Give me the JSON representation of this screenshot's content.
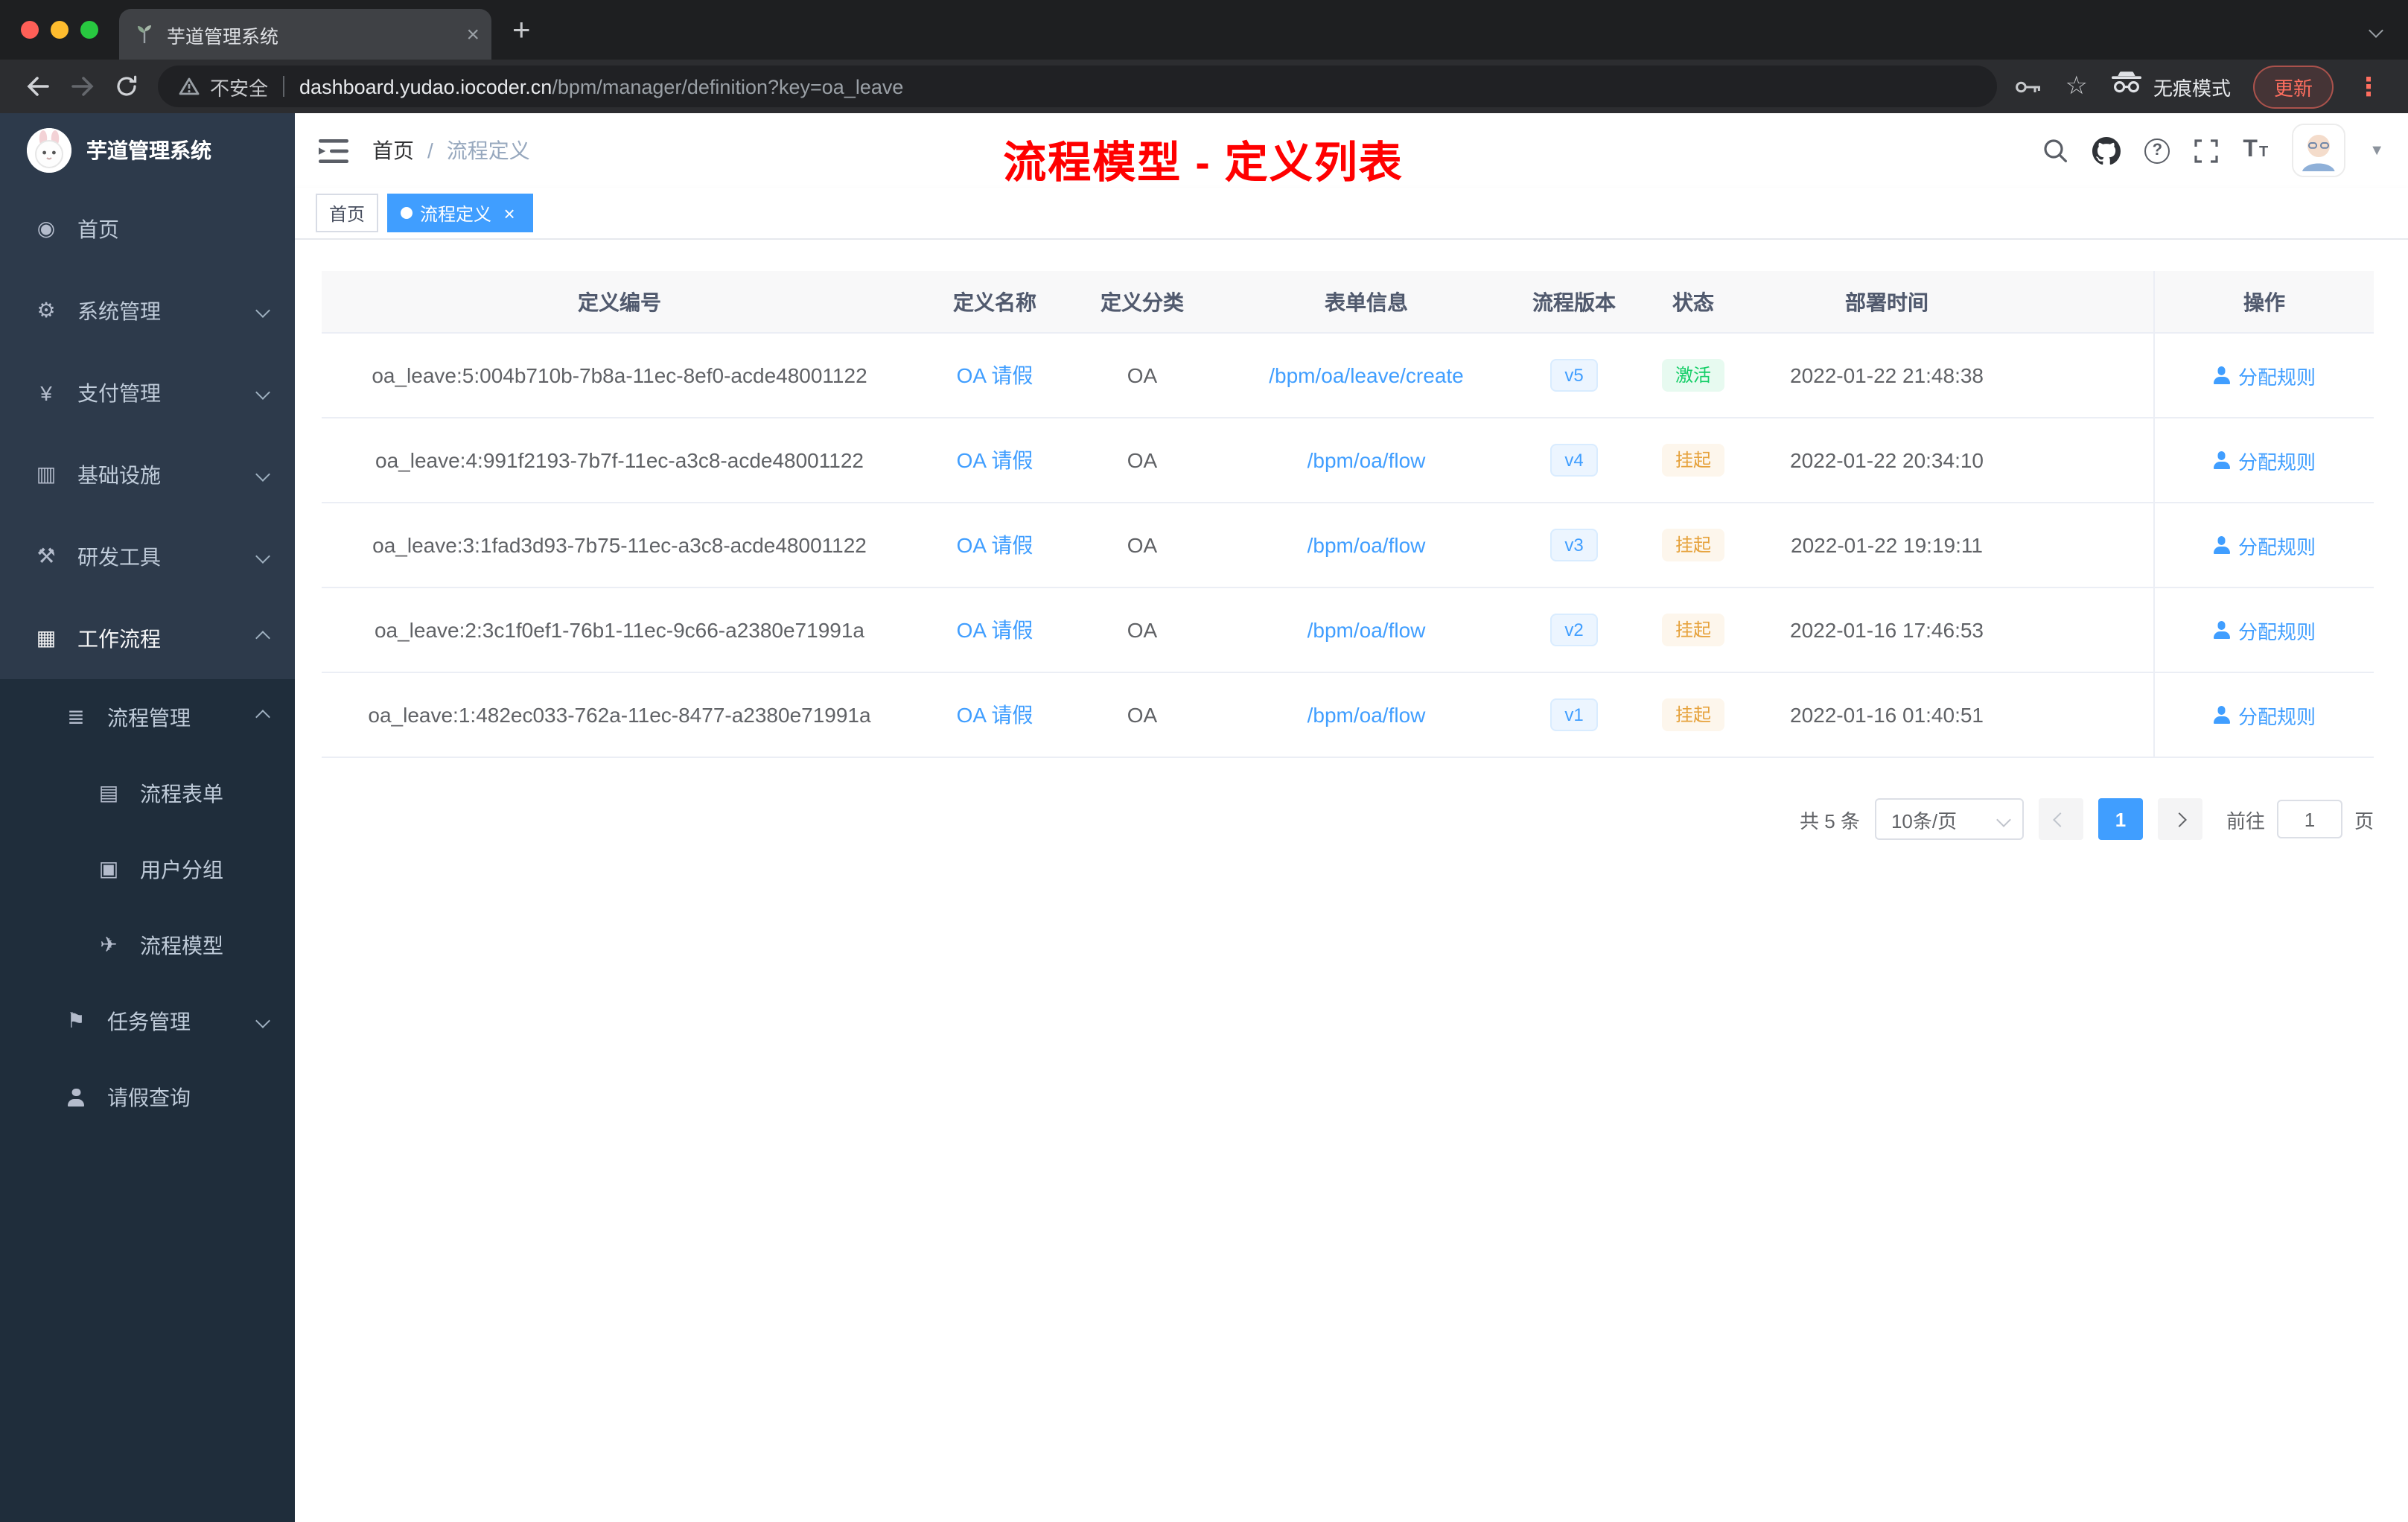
{
  "browser": {
    "tab_title": "芋道管理系统",
    "address": {
      "security_label": "不安全",
      "url_host": "dashboard.yudao.iocoder.cn",
      "url_path": "/bpm/manager/definition?key=oa_leave",
      "incognito_label": "无痕模式",
      "update_label": "更新"
    }
  },
  "glyphs": {
    "new_tab": "+",
    "tab_close": "×",
    "tag_close": "×",
    "menu_dots": "⋮",
    "star": "☆",
    "avatar_caret": "▼",
    "help": "?",
    "font_large": "T",
    "font_small": "T"
  },
  "sidebar": {
    "logo_title": "芋道管理系统",
    "menu": [
      {
        "label": "首页",
        "icon": "◉"
      },
      {
        "label": "系统管理",
        "icon": "⚙"
      },
      {
        "label": "支付管理",
        "icon": "¥"
      },
      {
        "label": "基础设施",
        "icon": "▥"
      },
      {
        "label": "研发工具",
        "icon": "⚒"
      },
      {
        "label": "工作流程",
        "icon": "▦"
      },
      {
        "label": "流程管理",
        "icon": "≣"
      },
      {
        "label": "流程表单",
        "icon": "▤"
      },
      {
        "label": "用户分组",
        "icon": "▣"
      },
      {
        "label": "流程模型",
        "icon": "✈"
      },
      {
        "label": "任务管理",
        "icon": "⚑"
      },
      {
        "label": "请假查询",
        "icon": ""
      }
    ]
  },
  "header": {
    "breadcrumb": {
      "home": "首页",
      "separator": "/",
      "current": "流程定义"
    },
    "overlay_title": "流程模型 - 定义列表"
  },
  "tags": [
    {
      "label": "首页"
    },
    {
      "label": "流程定义"
    }
  ],
  "table": {
    "headers": [
      "定义编号",
      "定义名称",
      "定义分类",
      "表单信息",
      "流程版本",
      "状态",
      "部署时间",
      "操作"
    ],
    "rows": [
      {
        "id": "oa_leave:5:004b710b-7b8a-11ec-8ef0-acde48001122",
        "name": "OA 请假",
        "category": "OA",
        "form": "/bpm/oa/leave/create",
        "version": "v5",
        "status": "激活",
        "time": "2022-01-22 21:48:38",
        "action": "分配规则"
      },
      {
        "id": "oa_leave:4:991f2193-7b7f-11ec-a3c8-acde48001122",
        "name": "OA 请假",
        "category": "OA",
        "form": "/bpm/oa/flow",
        "version": "v4",
        "status": "挂起",
        "time": "2022-01-22 20:34:10",
        "action": "分配规则"
      },
      {
        "id": "oa_leave:3:1fad3d93-7b75-11ec-a3c8-acde48001122",
        "name": "OA 请假",
        "category": "OA",
        "form": "/bpm/oa/flow",
        "version": "v3",
        "status": "挂起",
        "time": "2022-01-22 19:19:11",
        "action": "分配规则"
      },
      {
        "id": "oa_leave:2:3c1f0ef1-76b1-11ec-9c66-a2380e71991a",
        "name": "OA 请假",
        "category": "OA",
        "form": "/bpm/oa/flow",
        "version": "v2",
        "status": "挂起",
        "time": "2022-01-16 17:46:53",
        "action": "分配规则"
      },
      {
        "id": "oa_leave:1:482ec033-762a-11ec-8477-a2380e71991a",
        "name": "OA 请假",
        "category": "OA",
        "form": "/bpm/oa/flow",
        "version": "v1",
        "status": "挂起",
        "time": "2022-01-16 01:40:51",
        "action": "分配规则"
      }
    ]
  },
  "pagination": {
    "total": "共 5 条",
    "page_size": "10条/页",
    "current_page": "1",
    "goto_label": "前往",
    "goto_value": "1",
    "page_unit": "页"
  },
  "colors": {
    "accent": "#409eff",
    "title_red": "#ff0000",
    "success": "#13ce66",
    "warning": "#e6a23c",
    "sidebar": "#2d3a4b",
    "sidebar_dark": "#1f2d3b"
  }
}
